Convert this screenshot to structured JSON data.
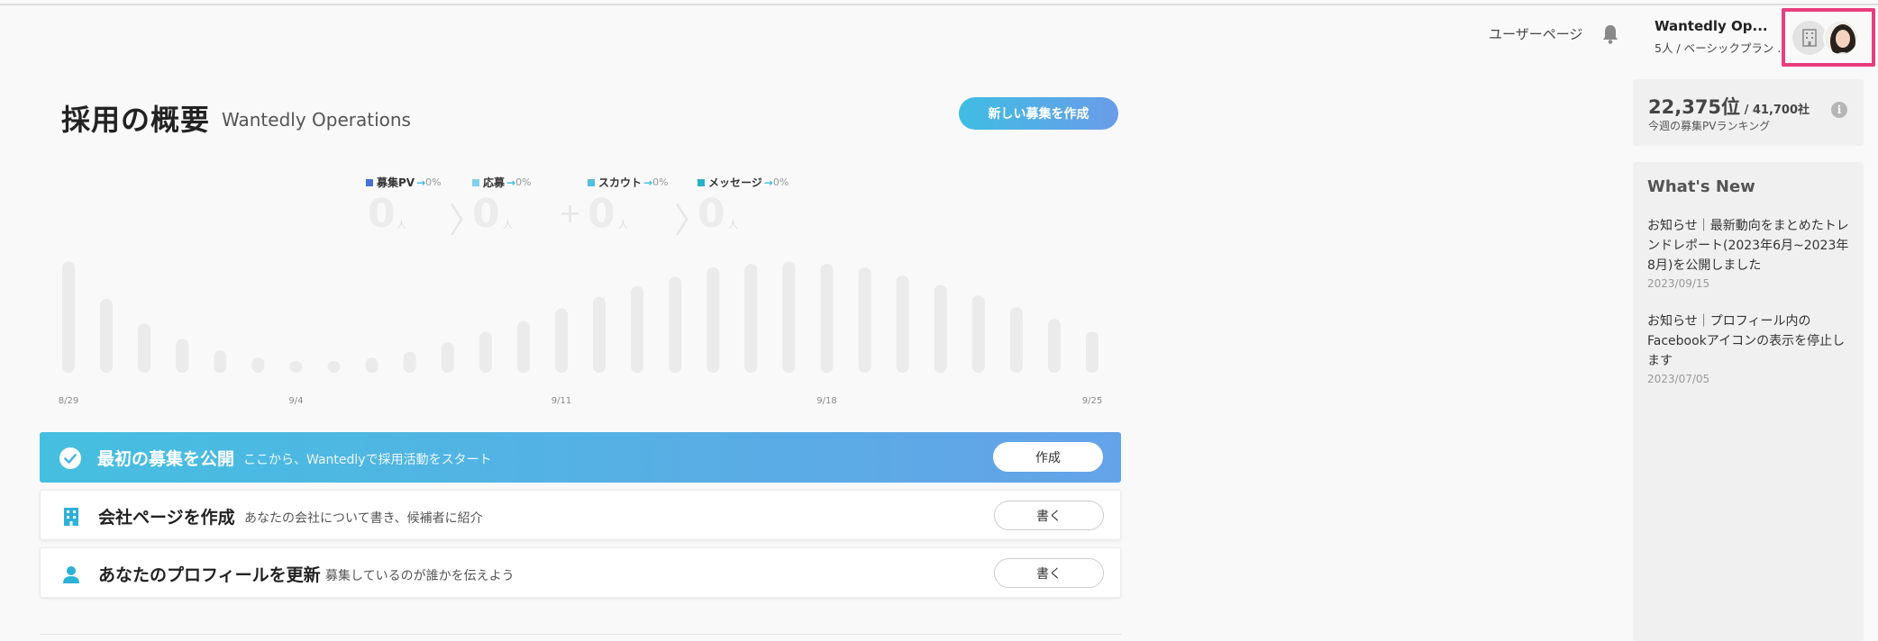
{
  "header": {
    "user_page_label": "ユーザーページ",
    "account_name": "Wantedly Op...",
    "account_plan": "5人 / ベーシックプラン ..."
  },
  "main": {
    "title": "採用の概要",
    "company": "Wantedly Operations",
    "create_button": "新しい募集を作成"
  },
  "stats": [
    {
      "label": "募集PV",
      "pct": "0%",
      "value": "0",
      "unit": "人",
      "color": "#4a6fd6"
    },
    {
      "label": "応募",
      "pct": "0%",
      "value": "0",
      "unit": "人",
      "color": "#7fd3e8"
    },
    {
      "label": "スカウト",
      "pct": "0%",
      "value": "0",
      "unit": "人",
      "color": "#4fc0e0"
    },
    {
      "label": "メッセージ",
      "pct": "0%",
      "value": "0",
      "unit": "人",
      "color": "#2bb0c9"
    }
  ],
  "chart_data": {
    "type": "bar",
    "x_tick_labels": [
      "8/29",
      "9/4",
      "9/11",
      "9/18",
      "9/25"
    ],
    "values": [
      95,
      63,
      42,
      29,
      19,
      13,
      10,
      10,
      13,
      18,
      26,
      35,
      44,
      55,
      65,
      74,
      82,
      90,
      93,
      95,
      93,
      90,
      83,
      75,
      66,
      56,
      46,
      35
    ]
  },
  "tasks": [
    {
      "title": "最初の募集を公開",
      "desc": "ここから、Wantedlyで採用活動をスタート",
      "button": "作成"
    },
    {
      "title": "会社ページを作成",
      "desc": "あなたの会社について書き、候補者に紹介",
      "button": "書く"
    },
    {
      "title": "あなたのプロフィールを更新",
      "desc": "募集しているのが誰かを伝えよう",
      "button": "書く"
    }
  ],
  "ranking": {
    "rank": "22,375位",
    "total": " / 41,700社",
    "caption": "今週の募集PVランキング",
    "info": "i"
  },
  "news": {
    "heading": "What's New",
    "items": [
      {
        "text": "お知らせ｜最新動向をまとめたトレンドレポート(2023年6月~2023年8月)を公開しました",
        "date": "2023/09/15"
      },
      {
        "text": "お知らせ｜プロフィール内のFacebookアイコンの表示を停止します",
        "date": "2023/07/05"
      }
    ]
  }
}
